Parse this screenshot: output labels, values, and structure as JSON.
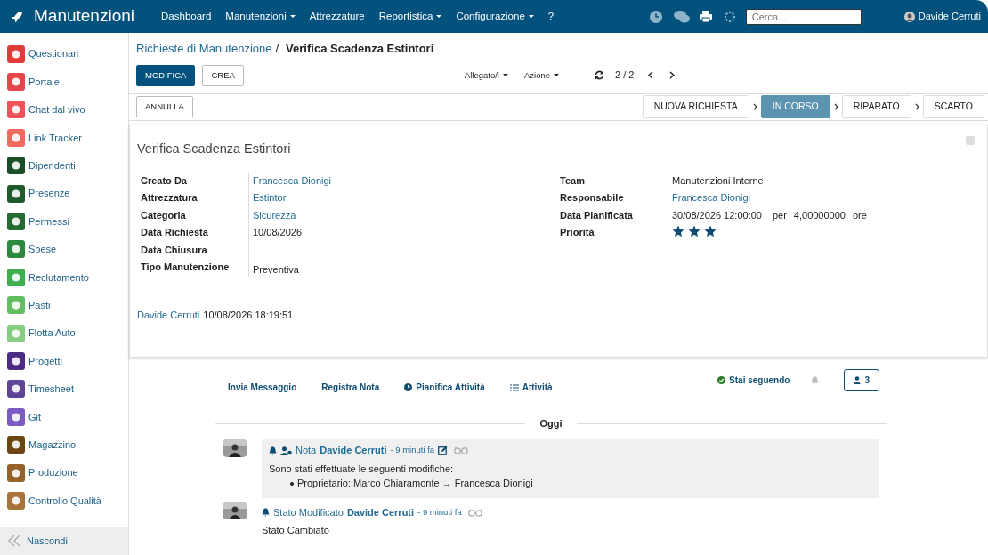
{
  "navbar": {
    "brand": "Manutenzioni",
    "menu": [
      {
        "label": "Dashboard",
        "dropdown": false
      },
      {
        "label": "Manutenzioni",
        "dropdown": true
      },
      {
        "label": "Attrezzature",
        "dropdown": false
      },
      {
        "label": "Reportistica",
        "dropdown": true
      },
      {
        "label": "Configurazione",
        "dropdown": true
      },
      {
        "label": "?",
        "dropdown": false
      }
    ],
    "search": {
      "placeholder": "Cerca..."
    },
    "user": "Davide Cerruti"
  },
  "sidebar": {
    "items": [
      {
        "label": "Questionari",
        "color": "#e03c3c"
      },
      {
        "label": "Portale",
        "color": "#e4474a"
      },
      {
        "label": "Chat dal vivo",
        "color": "#ec5257"
      },
      {
        "label": "Link Tracker",
        "color": "#ef6a5e"
      },
      {
        "label": "Dipendenti",
        "color": "#1b4d28"
      },
      {
        "label": "Presenze",
        "color": "#1f5b2b"
      },
      {
        "label": "Permessi",
        "color": "#236b31"
      },
      {
        "label": "Spese",
        "color": "#2b8a3e"
      },
      {
        "label": "Reclutamento",
        "color": "#3fae4f"
      },
      {
        "label": "Pasti",
        "color": "#62bd63"
      },
      {
        "label": "Flotta Auto",
        "color": "#86cd81"
      },
      {
        "label": "Progetti",
        "color": "#4b2d86"
      },
      {
        "label": "Timesheet",
        "color": "#5e4595"
      },
      {
        "label": "Git",
        "color": "#7a5cc0"
      },
      {
        "label": "Magazzino",
        "color": "#6b4512"
      },
      {
        "label": "Produzione",
        "color": "#94622a"
      },
      {
        "label": "Controllo Qualità",
        "color": "#a8743c"
      }
    ],
    "hide": "Nascondi"
  },
  "breadcrumb": {
    "parent": "Richieste di Manutenzione",
    "separator": "/",
    "current": "Verifica Scadenza Estintori"
  },
  "buttons": {
    "edit": "MODIFICA",
    "create": "CREA",
    "cancel": "ANNULLA"
  },
  "menus": [
    {
      "label": "Allegato/i"
    },
    {
      "label": "Azione"
    }
  ],
  "pager": "2 / 2",
  "stages": [
    {
      "label": "NUOVA RICHIESTA",
      "selected": false
    },
    {
      "label": "IN CORSO",
      "selected": true
    },
    {
      "label": "RIPARATO",
      "selected": false
    },
    {
      "label": "SCARTO",
      "selected": false
    }
  ],
  "form": {
    "title": "Verifica Scadenza Estintori",
    "checked": false,
    "left": [
      {
        "label": "Creato Da",
        "kind": "link",
        "value": "Francesca Dionigi"
      },
      {
        "label": "Attrezzatura",
        "kind": "link",
        "value": "Estintori"
      },
      {
        "label": "Categoria",
        "kind": "link",
        "value": "Sicurezza"
      },
      {
        "label": "Data Richiesta",
        "kind": "text",
        "value": "10/08/2026"
      },
      {
        "label": "Data Chiusura",
        "kind": "text"
      },
      {
        "label": "Tipo Manutenzione",
        "kind": "text",
        "value": "Preventiva"
      }
    ],
    "right": [
      {
        "label": "Team",
        "kind": "text",
        "value": "Manutenzioni Interne"
      },
      {
        "label": "Responsabile",
        "kind": "link",
        "value": "Francesca Dionigi"
      },
      {
        "label": "Data Pianificata",
        "kind": "planned",
        "value": "30/08/2026 12:00:00",
        "per": "per",
        "duration": "4,00000000",
        "unit": "ore"
      },
      {
        "label": "Priorità",
        "kind": "stars",
        "stars": 3
      }
    ],
    "author": "Davide Cerruti",
    "timestamp": "10/08/2026 18:19:51"
  },
  "chatter": {
    "actions": [
      {
        "label": "Invia Messaggio",
        "kind": "plain"
      },
      {
        "label": "Registra Nota",
        "kind": "plain"
      },
      {
        "label": "Pianifica Attività",
        "kind": "schedule"
      },
      {
        "label": "Attività",
        "kind": "list"
      }
    ],
    "following": "Stai seguendo",
    "followers": "3",
    "day": "Oggi",
    "messages": [
      {
        "kind": "note",
        "type": "Nota",
        "author": "Davide Cerruti",
        "time": "- 9 minuti fa",
        "text": "Sono stati effettuate le seguenti modifiche:",
        "change": {
          "field": "Proprietario: Marco Chiaramonte",
          "arrow": "→",
          "new": "Francesca Dionigi"
        }
      },
      {
        "kind": "stage",
        "type": "Stato Modificato",
        "author": "Davide Cerruti",
        "time": "- 9 minuti fa",
        "text": "Stato Cambiato"
      }
    ]
  }
}
